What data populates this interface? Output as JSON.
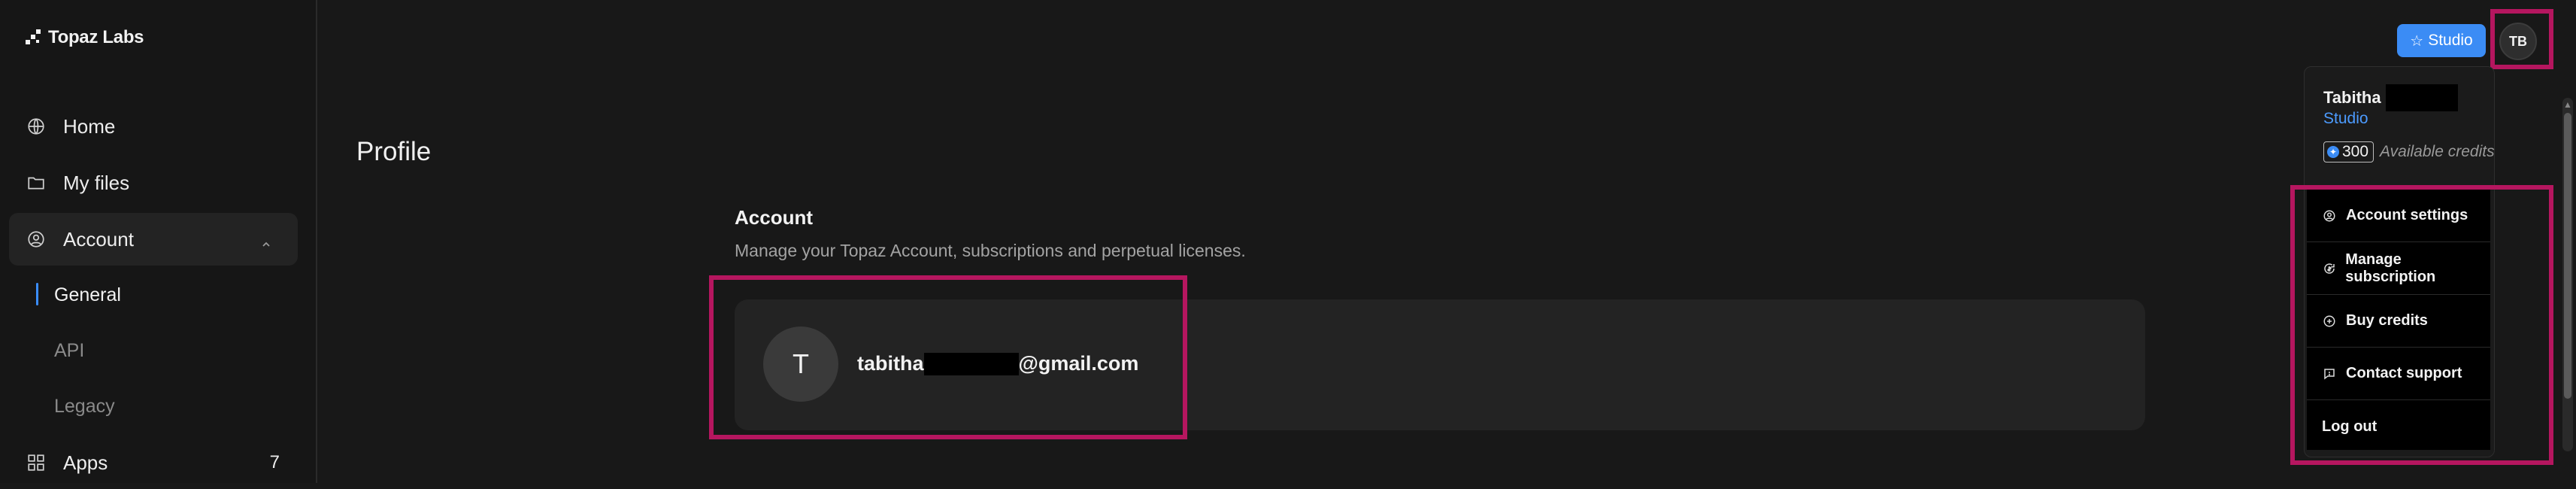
{
  "brand": {
    "name": "Topaz Labs"
  },
  "sidebar": {
    "items": [
      {
        "label": "Home",
        "icon": "home-icon"
      },
      {
        "label": "My files",
        "icon": "folder-icon"
      },
      {
        "label": "Account",
        "icon": "user-circle-icon"
      },
      {
        "label": "Apps",
        "icon": "grid-icon",
        "count": "7"
      }
    ],
    "account_subitems": [
      {
        "label": "General"
      },
      {
        "label": "API"
      },
      {
        "label": "Legacy"
      }
    ]
  },
  "main": {
    "page_title": "Profile",
    "section_title": "Account",
    "section_desc": "Manage your Topaz Account, subscriptions and perpetual licenses.",
    "avatar_initial": "T",
    "email_prefix": "tabitha",
    "email_suffix": "@gmail.com"
  },
  "header": {
    "studio_label": "Studio",
    "avatar_initials": "TB"
  },
  "dropdown": {
    "user_first_name": "Tabitha",
    "plan": "Studio",
    "credits": "300",
    "credits_label": "Available credits",
    "menu": [
      {
        "label": "Account settings",
        "icon": "user-circle-icon"
      },
      {
        "label": "Manage subscription",
        "icon": "refresh-dollar-icon"
      },
      {
        "label": "Buy credits",
        "icon": "plus-circle-icon"
      },
      {
        "label": "Contact support",
        "icon": "chat-icon"
      },
      {
        "label": "Log out",
        "icon": ""
      }
    ]
  },
  "colors": {
    "accent": "#3b8cf5",
    "highlight": "#b5165f",
    "background": "#181818",
    "card": "#232323"
  }
}
